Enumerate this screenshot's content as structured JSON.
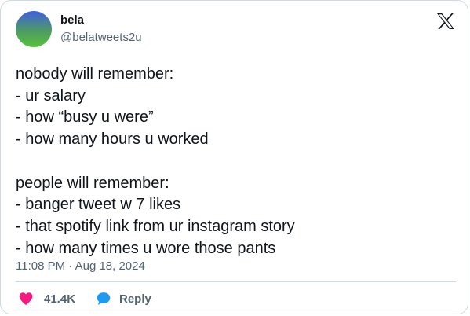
{
  "author": {
    "display_name": "bela",
    "handle": "@belatweets2u"
  },
  "tweet": {
    "text": "nobody will remember:\n- ur salary\n- how “busy u were”\n- how many hours u worked\n\npeople will remember:\n- banger tweet w 7 likes\n- that spotify link from ur instagram story\n- how many times u wore those pants",
    "timestamp": "11:08 PM · Aug 18, 2024"
  },
  "actions": {
    "like_count": "41.4K",
    "reply_label": "Reply"
  },
  "icons": {
    "brand": "x-logo-icon",
    "like": "heart-icon",
    "reply": "speech-bubble-icon"
  },
  "colors": {
    "heart": "#f91880",
    "reply_bubble": "#1d9bf0",
    "secondary_text": "#536471",
    "primary_text": "#0f1419",
    "border": "#cfd9de"
  }
}
